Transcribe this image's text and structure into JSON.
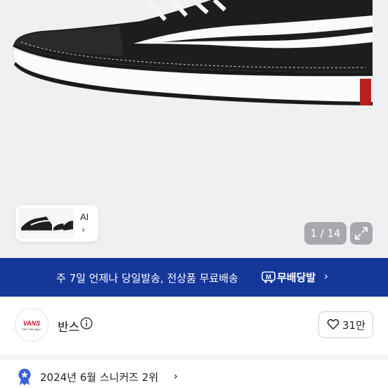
{
  "gallery": {
    "thumb_ai_label": "AI",
    "thumb_chevron": "›",
    "counter": "1 / 14",
    "expand_icon": "expand-icon"
  },
  "banner": {
    "text": "주 7일 언제나 당일발송, 전상품 무료배송",
    "brand": "무배당발",
    "chevron": "›",
    "bg_color": "#15379a"
  },
  "seller": {
    "avatar_text": "VANS",
    "avatar_sub": "\"OFF THE WALL\"",
    "name": "반스",
    "like_count": "31만"
  },
  "ranking": {
    "text": "2024년 6월 스니커즈 2위",
    "chevron": "›",
    "badge_color": "#3a5fd8"
  }
}
